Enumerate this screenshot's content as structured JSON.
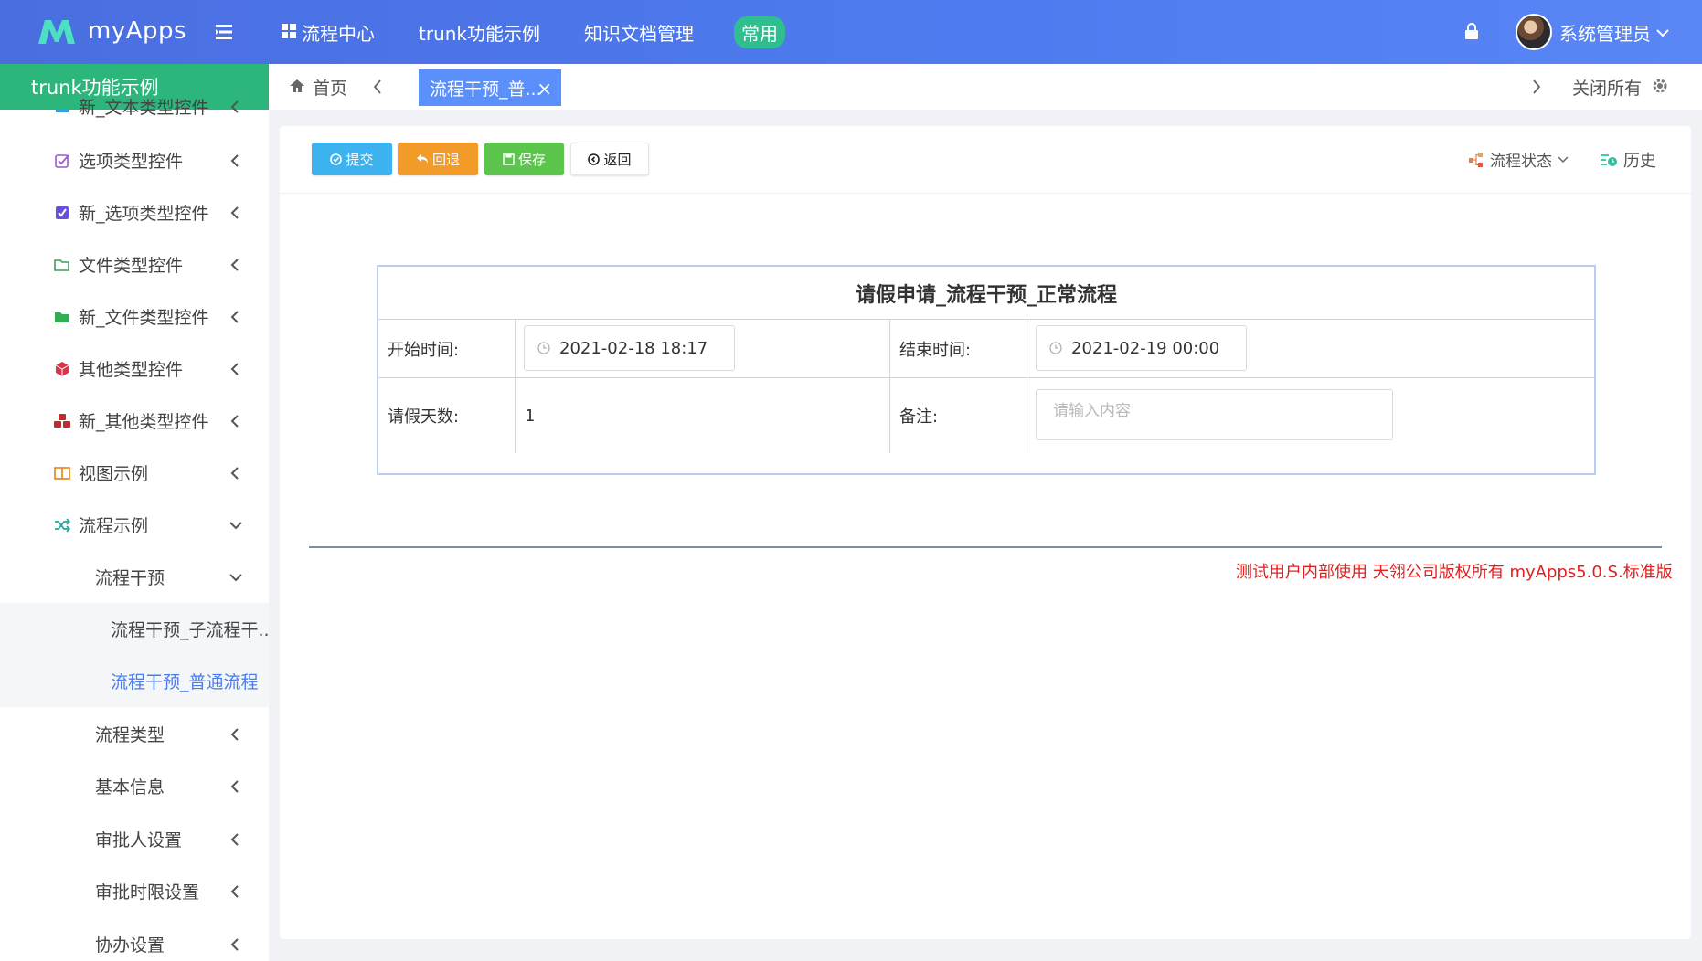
{
  "header": {
    "app_name": "myApps",
    "nav": [
      "流程中心",
      "trunk功能示例",
      "知识文档管理"
    ],
    "pill": "常用",
    "user_name": "系统管理员",
    "brand_color": "#4e7cf0"
  },
  "sidebar": {
    "title": "trunk功能示例",
    "items": [
      {
        "label": "新_文本类型控件",
        "icon": "text-icon"
      },
      {
        "label": "选项类型控件",
        "icon": "checkbox-outline-icon"
      },
      {
        "label": "新_选项类型控件",
        "icon": "checkbox-filled-icon"
      },
      {
        "label": "文件类型控件",
        "icon": "folder-outline-icon"
      },
      {
        "label": "新_文件类型控件",
        "icon": "folder-filled-icon"
      },
      {
        "label": "其他类型控件",
        "icon": "cube-icon"
      },
      {
        "label": "新_其他类型控件",
        "icon": "cubes-icon"
      },
      {
        "label": "视图示例",
        "icon": "columns-icon"
      },
      {
        "label": "流程示例",
        "icon": "shuffle-icon"
      },
      {
        "label": "流程干预"
      },
      {
        "label": "流程干预_子流程干..."
      },
      {
        "label": "流程干预_普通流程"
      },
      {
        "label": "流程类型"
      },
      {
        "label": "基本信息"
      },
      {
        "label": "审批人设置"
      },
      {
        "label": "审批时限设置"
      },
      {
        "label": "协办设置"
      }
    ]
  },
  "tabs": {
    "home": "首页",
    "active": "流程干预_普...",
    "close_all": "关闭所有"
  },
  "toolbar": {
    "submit": "提交",
    "back": "回退",
    "save": "保存",
    "return": "返回",
    "flow_state": "流程状态",
    "history": "历史"
  },
  "form": {
    "title": "请假申请_流程干预_正常流程",
    "start_label": "开始时间:",
    "start_value": "2021-02-18 18:17",
    "end_label": "结束时间:",
    "end_value": "2021-02-19 00:00",
    "days_label": "请假天数:",
    "days_value": "1",
    "remark_label": "备注:",
    "remark_placeholder": "请输入内容"
  },
  "footer": {
    "note": "测试用户内部使用 天翎公司版权所有 myApps5.0.S.标准版"
  }
}
